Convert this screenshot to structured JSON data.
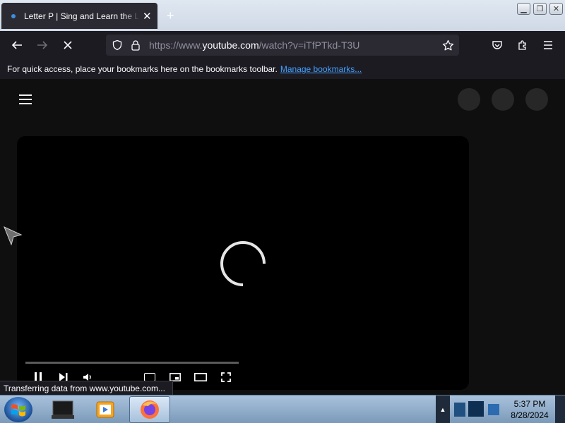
{
  "browser": {
    "tab": {
      "title": "Letter P | Sing and Learn the Letters",
      "close_glyph": "✕"
    },
    "new_tab_glyph": "+",
    "window_controls": {
      "minimize": "▁",
      "restore": "❐",
      "close": "✕"
    },
    "nav": {
      "back_icon": "arrow-left",
      "forward_icon": "arrow-right",
      "stop_icon": "x"
    },
    "address": {
      "prefix": "https://www.",
      "domain": "youtube.com",
      "path": "/watch?v=iTfPTkd-T3U"
    },
    "bookmarks_bar": {
      "message": "For quick access, place your bookmarks here on the bookmarks toolbar.",
      "link": "Manage bookmarks..."
    },
    "status_text": "Transferring data from www.youtube.com..."
  },
  "taskbar": {
    "clock": {
      "time": "5:37 PM",
      "date": "8/28/2024"
    }
  },
  "colors": {
    "accent_link": "#45a1ff",
    "tab_active": "#2b2a33",
    "toolbar": "#1c1b22",
    "page_bg": "#0f0f0f"
  }
}
